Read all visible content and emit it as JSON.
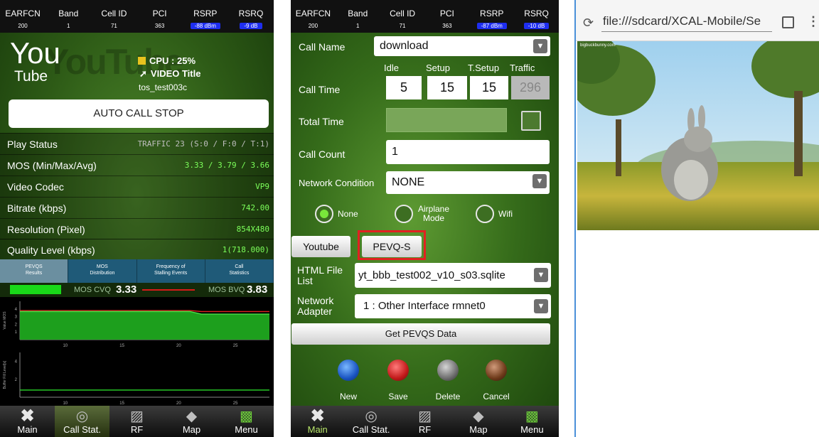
{
  "status_header": {
    "cols": [
      {
        "label": "EARFCN",
        "value": "200"
      },
      {
        "label": "Band",
        "value": "1"
      },
      {
        "label": "Cell ID",
        "value": "71"
      },
      {
        "label": "PCI",
        "value": "363"
      },
      {
        "label": "RSRP",
        "value_left": "-88 dBm",
        "value_mid": "-87 dBm"
      },
      {
        "label": "RSRQ",
        "value_left": "-9 dB",
        "value_mid": "-10 dB"
      }
    ]
  },
  "left": {
    "logo_you": "You",
    "logo_tube": "Tube",
    "cpu": "CPU : 25%",
    "video_title": "VIDEO Title",
    "video_id": "tos_test003c",
    "auto_call_stop": "AUTO CALL STOP",
    "rows": [
      {
        "label": "Play Status",
        "value": "TRAFFIC 23 (S:0 / F:0 / T:1)"
      },
      {
        "label": "MOS (Min/Max/Avg)",
        "value": "3.33 / 3.79 / 3.66"
      },
      {
        "label": "Video Codec",
        "value": "VP9"
      },
      {
        "label": "Bitrate (kbps)",
        "value": "742.00"
      },
      {
        "label": "Resolution (Pixel)",
        "value": "854X480"
      },
      {
        "label": "Quality Level (kbps)",
        "value": "1(718.000)"
      }
    ],
    "pevqs_tabs": [
      {
        "line1": "PEVQS",
        "line2": "Results"
      },
      {
        "line1": "MOS",
        "line2": "Distribution"
      },
      {
        "line1": "Frequency of",
        "line2": "Stalling Events"
      },
      {
        "line1": "Call",
        "line2": "Statistics"
      }
    ],
    "mos_cvq_label": "MOS CVQ",
    "mos_cvq_value": "3.33",
    "mos_bvq_label": "MOS BVQ",
    "mos_bvq_value": "3.83",
    "plot1_ylabel": "Value MOS",
    "plot2_ylabel": "Buffer Fill Level[s]",
    "x_ticks": [
      "10",
      "15",
      "20",
      "25"
    ],
    "plot1_yticks": [
      "1",
      "2",
      "3",
      "4"
    ],
    "plot2_yticks": [
      "2",
      "4"
    ]
  },
  "bottom_tabs": [
    {
      "label": "Main",
      "icon": "x-icon"
    },
    {
      "label": "Call Stat.",
      "icon": "gauge-icon"
    },
    {
      "label": "RF",
      "icon": "waveform-icon"
    },
    {
      "label": "Map",
      "icon": "map-icon"
    },
    {
      "label": "Menu",
      "icon": "menu-icon"
    }
  ],
  "mid": {
    "call_name_label": "Call Name",
    "call_name_value": "download",
    "col_headers": [
      "Idle",
      "Setup",
      "T.Setup",
      "Traffic"
    ],
    "call_time_label": "Call Time",
    "call_time_values": [
      "5",
      "15",
      "15",
      "296"
    ],
    "total_time_label": "Total Time",
    "call_count_label": "Call Count",
    "call_count_value": "1",
    "network_condition_label": "Network Condition",
    "network_condition_value": "NONE",
    "radio_none": "None",
    "radio_airplane_1": "Airplane",
    "radio_airplane_2": "Mode",
    "radio_wifi": "Wifi",
    "btn_youtube": "Youtube",
    "btn_pevqs": "PEVQ-S",
    "html_file_label_1": "HTML File",
    "html_file_label_2": "List",
    "html_file_value": "yt_bbb_test002_v10_s03.sqlite",
    "network_adapter_label_1": "Network",
    "network_adapter_label_2": "Adapter",
    "network_adapter_value": "1 : Other Interface rmnet0",
    "get_pevqs": "Get PEVQS Data",
    "action_new": "New",
    "action_save": "Save",
    "action_delete": "Delete",
    "action_cancel": "Cancel"
  },
  "right": {
    "url": "file:///sdcard/XCAL-Mobile/Se",
    "video_caption": "bigbuckbunny.com"
  },
  "chart_data": [
    {
      "type": "line",
      "x": [
        6,
        21,
        22,
        28
      ],
      "series": [
        {
          "values": [
            3.79,
            3.79,
            3.66,
            3.66
          ]
        },
        {
          "values": [
            3.66,
            3.66,
            3.33,
            3.33
          ]
        }
      ],
      "xlim": [
        6,
        28
      ],
      "ylim": [
        0,
        5
      ],
      "ylabel": "Value MOS",
      "x_ticks": [
        10,
        15,
        20,
        25
      ]
    },
    {
      "type": "line",
      "x": [
        6,
        28
      ],
      "series": [
        {
          "values": [
            0.8,
            0.8
          ]
        }
      ],
      "xlim": [
        6,
        28
      ],
      "ylim": [
        0,
        5
      ],
      "ylabel": "Buffer Fill Level[s]",
      "x_ticks": [
        10,
        15,
        20,
        25
      ]
    }
  ]
}
